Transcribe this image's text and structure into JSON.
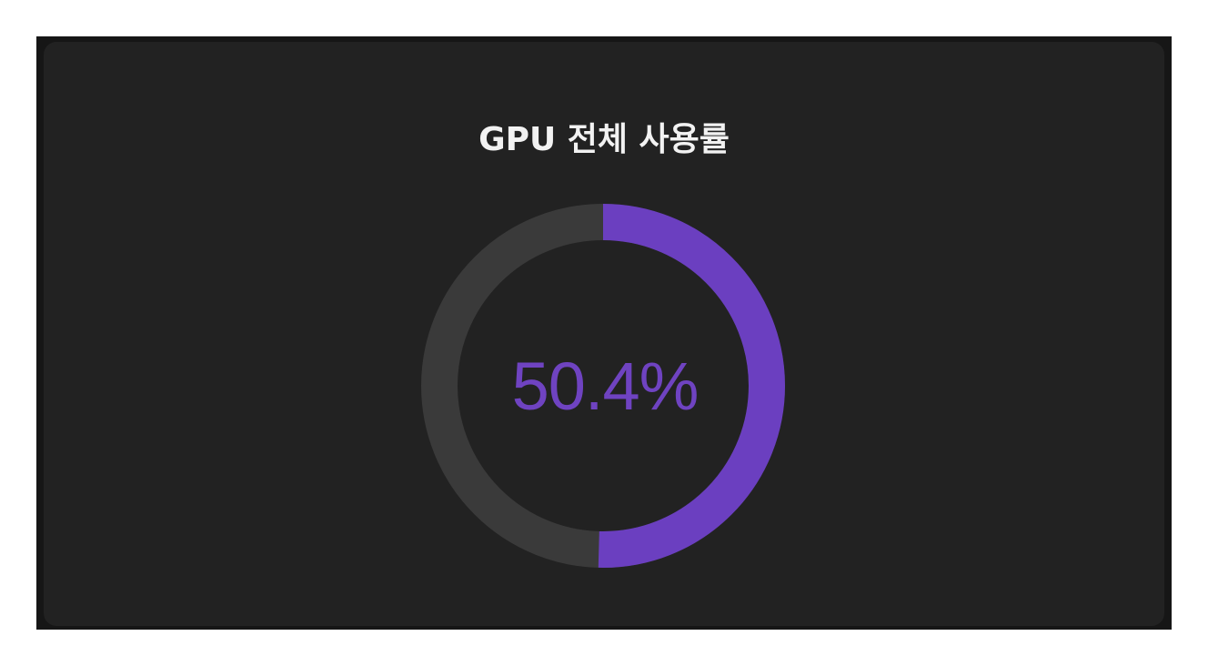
{
  "widget": {
    "title": "GPU 전체 사용률",
    "value_text": "50.4%",
    "percent": 50.4
  },
  "colors": {
    "frame": "#161616",
    "card": "#222222",
    "track": "#3a3a3a",
    "progress": "#6b3fc0",
    "value_text": "#6f43c1",
    "title_text": "#f2f2f2"
  }
}
